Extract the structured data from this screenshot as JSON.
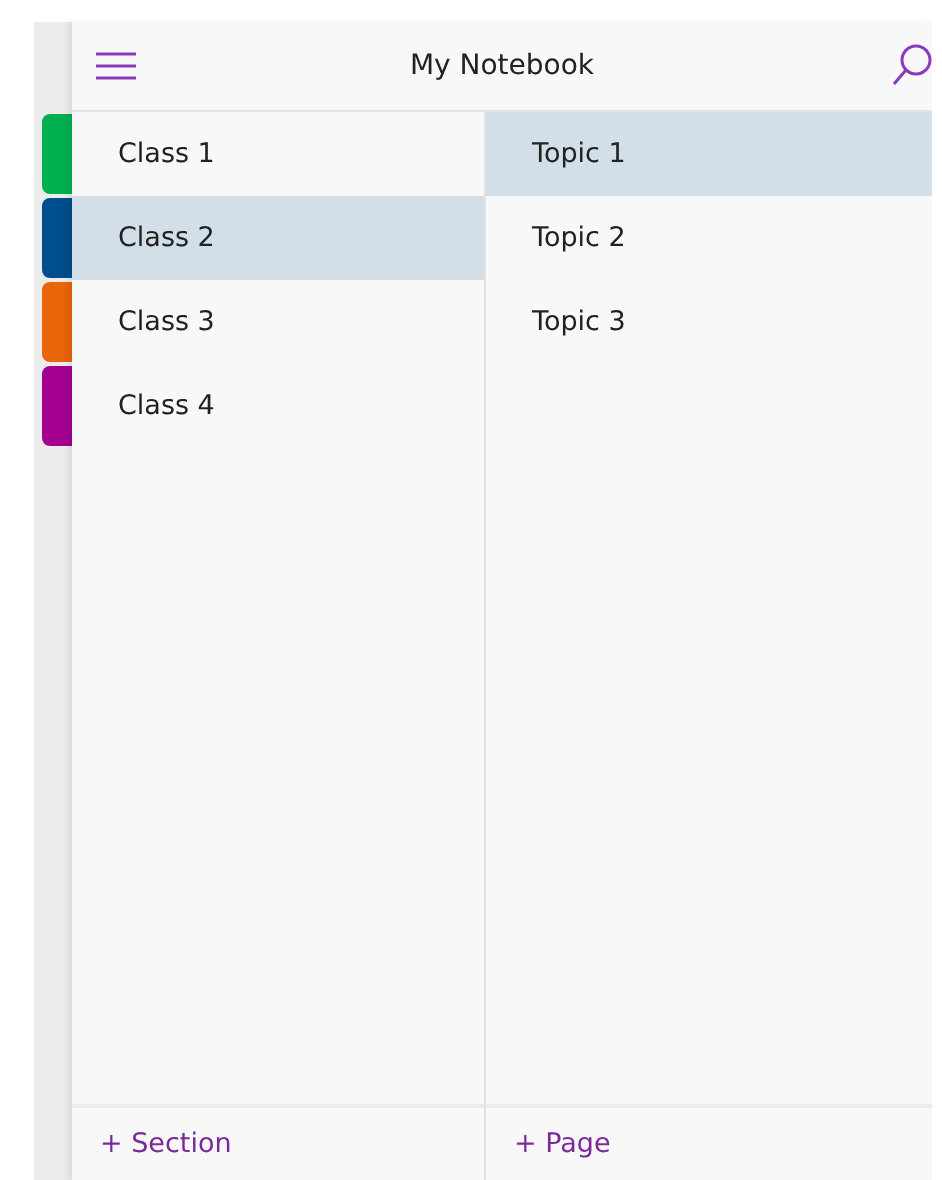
{
  "header": {
    "title": "My Notebook"
  },
  "sections": [
    {
      "label": "Class 1",
      "color": "#00b050",
      "selected": false
    },
    {
      "label": "Class 2",
      "color": "#004e8c",
      "selected": true
    },
    {
      "label": "Class 3",
      "color": "#e8650a",
      "selected": false
    },
    {
      "label": "Class 4",
      "color": "#a4008f",
      "selected": false
    }
  ],
  "pages": [
    {
      "label": "Topic 1",
      "selected": true
    },
    {
      "label": "Topic 2",
      "selected": false
    },
    {
      "label": "Topic 3",
      "selected": false
    }
  ],
  "footer": {
    "add_section": "+ Section",
    "add_page": "+ Page"
  }
}
